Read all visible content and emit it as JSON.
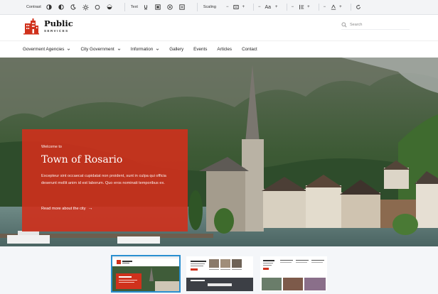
{
  "toolbar": {
    "contrast_label": "Contrast",
    "text_label": "Text",
    "scaling_label": "Scaling",
    "font_size_label": "Aa",
    "icons": [
      "contrast-half-icon",
      "contrast-dark-icon",
      "moon-icon",
      "sun-icon",
      "drop-icon",
      "invert-icon",
      "underline-icon",
      "image-toggle-icon",
      "cursor-icon",
      "reading-icon",
      "zoom-out-icon",
      "zoom-in-icon",
      "line-height-icon",
      "letter-spacing-icon",
      "reset-icon"
    ],
    "minus": "−",
    "plus": "+"
  },
  "brand": {
    "title": "Public",
    "subtitle": "SERVICES",
    "accent": "#d0311c"
  },
  "search": {
    "placeholder": "Search"
  },
  "nav": {
    "items": [
      {
        "label": "Goverment Agencies",
        "dropdown": true
      },
      {
        "label": "City Government",
        "dropdown": true
      },
      {
        "label": "Information",
        "dropdown": true
      },
      {
        "label": "Gallery",
        "dropdown": false
      },
      {
        "label": "Events",
        "dropdown": false
      },
      {
        "label": "Articles",
        "dropdown": false
      },
      {
        "label": "Contact",
        "dropdown": false
      }
    ]
  },
  "hero": {
    "eyebrow": "Welcome to",
    "title": "Town of Rosario",
    "description": "Excepteur sint occaecat cupidatat non proident, sunt in culpa qui officia deserunt mollit anim id est laborum. Quo eros nominati temporibus ex.",
    "more_label": "Read more about the city",
    "more_arrow": "→"
  },
  "thumbnails": {
    "active_index": 0,
    "count": 3
  }
}
